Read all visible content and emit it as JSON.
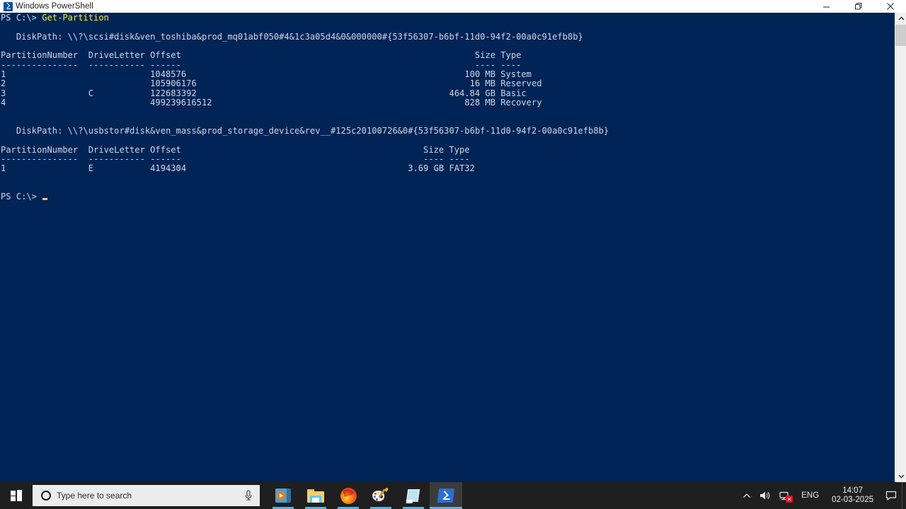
{
  "window": {
    "title": "Windows PowerShell",
    "icon": "powershell-icon",
    "controls": {
      "minimize": "minimize",
      "maximize": "restore",
      "close": "close"
    }
  },
  "console": {
    "background_color": "#012456",
    "foreground_color": "#ccd6e4",
    "command_color": "#f3f32e",
    "prompt": "PS C:\\> ",
    "command": "Get-Partition",
    "lines": [
      {
        "type": "prompt",
        "prompt": "PS C:\\> ",
        "command": "Get-Partition"
      },
      {
        "type": "blank",
        "text": ""
      },
      {
        "type": "text",
        "text": "   DiskPath: \\\\?\\scsi#disk&ven_toshiba&prod_mq01abf050#4&1c3a05d4&0&000000#{53f56307-b6bf-11d0-94f2-00a0c91efb8b}"
      },
      {
        "type": "blank",
        "text": ""
      },
      {
        "type": "text",
        "text": "PartitionNumber  DriveLetter Offset                                                         Size Type"
      },
      {
        "type": "text",
        "text": "---------------  ----------- ------                                                         ---- ----"
      },
      {
        "type": "text",
        "text": "1                            1048576                                                      100 MB System"
      },
      {
        "type": "text",
        "text": "2                            105906176                                                     16 MB Reserved"
      },
      {
        "type": "text",
        "text": "3                C           122683392                                                 464.84 GB Basic"
      },
      {
        "type": "text",
        "text": "4                            499239616512                                                 828 MB Recovery"
      },
      {
        "type": "blank",
        "text": ""
      },
      {
        "type": "blank",
        "text": ""
      },
      {
        "type": "text",
        "text": "   DiskPath: \\\\?\\usbstor#disk&ven_mass&prod_storage_device&rev__#125c20100726&0#{53f56307-b6bf-11d0-94f2-00a0c91efb8b}"
      },
      {
        "type": "blank",
        "text": ""
      },
      {
        "type": "text",
        "text": "PartitionNumber  DriveLetter Offset                                               Size Type"
      },
      {
        "type": "text",
        "text": "---------------  ----------- ------                                               ---- ----"
      },
      {
        "type": "text",
        "text": "1                E           4194304                                           3.69 GB FAT32"
      },
      {
        "type": "blank",
        "text": ""
      },
      {
        "type": "blank",
        "text": ""
      },
      {
        "type": "endprompt",
        "prompt": "PS C:\\> "
      }
    ],
    "disks": [
      {
        "disk_path": "\\\\?\\scsi#disk&ven_toshiba&prod_mq01abf050#4&1c3a05d4&0&000000#{53f56307-b6bf-11d0-94f2-00a0c91efb8b}",
        "columns": [
          "PartitionNumber",
          "DriveLetter",
          "Offset",
          "Size",
          "Type"
        ],
        "rows": [
          {
            "PartitionNumber": "1",
            "DriveLetter": "",
            "Offset": "1048576",
            "Size": "100 MB",
            "Type": "System"
          },
          {
            "PartitionNumber": "2",
            "DriveLetter": "",
            "Offset": "105906176",
            "Size": "16 MB",
            "Type": "Reserved"
          },
          {
            "PartitionNumber": "3",
            "DriveLetter": "C",
            "Offset": "122683392",
            "Size": "464.84 GB",
            "Type": "Basic"
          },
          {
            "PartitionNumber": "4",
            "DriveLetter": "",
            "Offset": "499239616512",
            "Size": "828 MB",
            "Type": "Recovery"
          }
        ]
      },
      {
        "disk_path": "\\\\?\\usbstor#disk&ven_mass&prod_storage_device&rev__#125c20100726&0#{53f56307-b6bf-11d0-94f2-00a0c91efb8b}",
        "columns": [
          "PartitionNumber",
          "DriveLetter",
          "Offset",
          "Size",
          "Type"
        ],
        "rows": [
          {
            "PartitionNumber": "1",
            "DriveLetter": "E",
            "Offset": "4194304",
            "Size": "3.69 GB",
            "Type": "FAT32"
          }
        ]
      }
    ]
  },
  "scrollbar": {
    "up_arrow": "▲",
    "down_arrow": "▼"
  },
  "taskbar": {
    "start": "start-button",
    "search": {
      "placeholder": "Type here to search",
      "icon": "search-circle-icon",
      "mic": "microphone-icon"
    },
    "apps": [
      {
        "name": "media-player",
        "label": "Media Player",
        "active": false,
        "running": true
      },
      {
        "name": "file-explorer",
        "label": "File Explorer",
        "active": false,
        "running": true
      },
      {
        "name": "firefox",
        "label": "Mozilla Firefox",
        "active": false,
        "running": true
      },
      {
        "name": "paint",
        "label": "Paint",
        "active": false,
        "running": true
      },
      {
        "name": "sticky-notes",
        "label": "Sticky Notes",
        "active": false,
        "running": true
      },
      {
        "name": "windows-powershell",
        "label": "Windows PowerShell",
        "active": true,
        "running": true
      }
    ],
    "tray": {
      "chevron": "show-hidden-icons",
      "volume": "volume-icon",
      "network": "network-disconnected-icon",
      "language": "ENG",
      "time": "14:07",
      "date": "02-03-2025",
      "action_center": "notifications-icon"
    }
  }
}
